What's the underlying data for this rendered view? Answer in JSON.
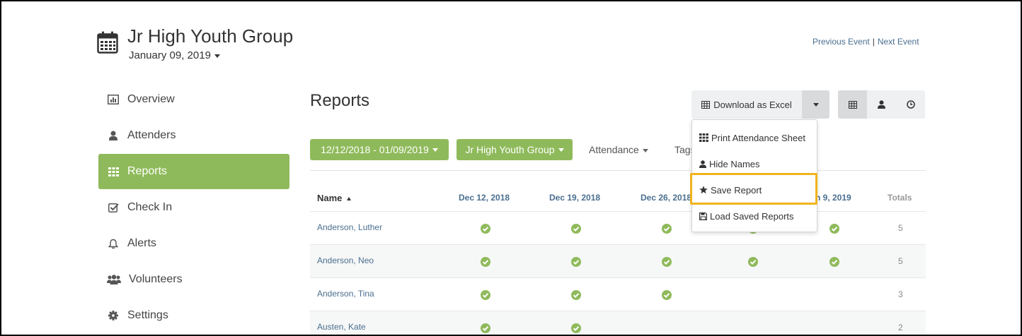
{
  "header": {
    "title": "Jr High Youth Group",
    "date": "January 09, 2019",
    "prev_event": "Previous Event",
    "separator": "|",
    "next_event": "Next Event"
  },
  "sidebar": {
    "items": [
      {
        "label": "Overview",
        "icon": "bar-chart-icon"
      },
      {
        "label": "Attenders",
        "icon": "user-icon"
      },
      {
        "label": "Reports",
        "icon": "grid-icon",
        "active": true
      },
      {
        "label": "Check In",
        "icon": "checkbox-icon"
      },
      {
        "label": "Alerts",
        "icon": "bell-icon"
      },
      {
        "label": "Volunteers",
        "icon": "users-icon"
      },
      {
        "label": "Settings",
        "icon": "gear-icon"
      }
    ]
  },
  "main": {
    "title": "Reports",
    "download_label": "Download as Excel",
    "filters": {
      "date_range": "12/12/2018 - 01/09/2019",
      "group": "Jr High Youth Group",
      "attendance": "Attendance",
      "tags": "Tags"
    },
    "dropdown": {
      "items": [
        {
          "label": "Print Attendance Sheet",
          "icon": "grid-icon"
        },
        {
          "label": "Hide Names",
          "icon": "user-icon"
        },
        {
          "label": "Save Report",
          "icon": "star-icon",
          "highlighted": true
        },
        {
          "label": "Load Saved Reports",
          "icon": "floppy-icon"
        }
      ]
    },
    "table": {
      "columns": [
        "Name",
        "Dec 12, 2018",
        "Dec 19, 2018",
        "Dec 26, 2018",
        "n 9, 2019",
        "Totals"
      ],
      "rows": [
        {
          "name": "Anderson, Luther",
          "attended": [
            true,
            true,
            true,
            true,
            true
          ],
          "total": "5"
        },
        {
          "name": "Anderson, Neo",
          "attended": [
            true,
            true,
            true,
            true,
            true
          ],
          "total": "5"
        },
        {
          "name": "Anderson, Tina",
          "attended": [
            true,
            true,
            true,
            false,
            false
          ],
          "total": "3"
        },
        {
          "name": "Austen, Kate",
          "attended": [
            true,
            true,
            false,
            false,
            false
          ],
          "total": "2"
        }
      ]
    }
  },
  "colors": {
    "accent_green": "#8fba5b",
    "link_blue": "#4a6f8f",
    "highlight_yellow": "#f0b41c",
    "check_green": "#8fba5b"
  }
}
